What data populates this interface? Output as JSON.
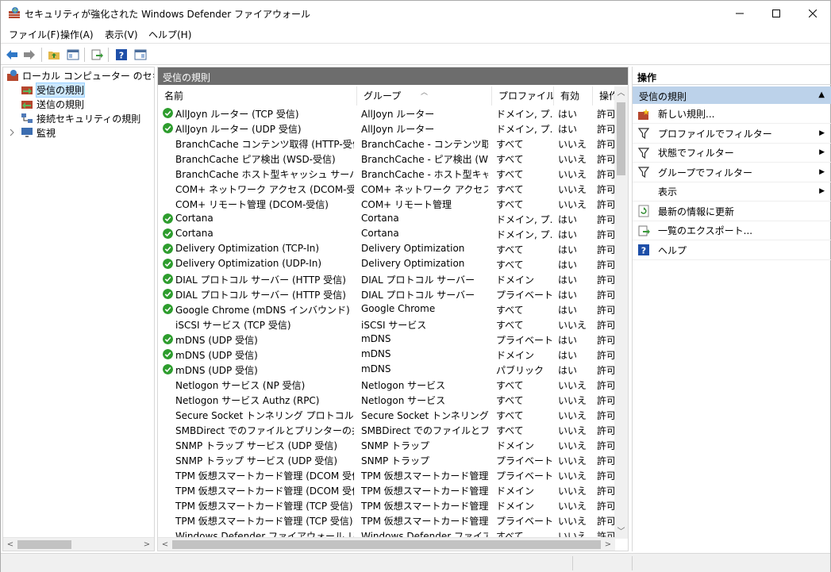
{
  "window": {
    "title": "セキュリティが強化された Windows Defender ファイアウォール"
  },
  "menu": [
    "ファイル(F)",
    "操作(A)",
    "表示(V)",
    "ヘルプ(H)"
  ],
  "tree": {
    "root": "ローカル コンピューター のセキュリティ",
    "items": [
      "受信の規則",
      "送信の規則",
      "接続セキュリティの規則",
      "監視"
    ]
  },
  "center": {
    "title": "受信の規則",
    "columns": [
      "名前",
      "グループ",
      "プロファイル",
      "有効",
      "操作"
    ],
    "rows": [
      {
        "name": "AllJoyn ルーター (TCP 受信)",
        "group": "AllJoyn ルーター",
        "profile": "ドメイン, プ...",
        "enabled": "はい",
        "action": "許可",
        "check": true
      },
      {
        "name": "AllJoyn ルーター (UDP 受信)",
        "group": "AllJoyn ルーター",
        "profile": "ドメイン, プ...",
        "enabled": "はい",
        "action": "許可",
        "check": true
      },
      {
        "name": "BranchCache コンテンツ取得 (HTTP-受信)",
        "group": "BranchCache - コンテンツ取得...",
        "profile": "すべて",
        "enabled": "いいえ",
        "action": "許可",
        "check": false
      },
      {
        "name": "BranchCache ピア検出 (WSD-受信)",
        "group": "BranchCache - ピア検出 (WS...",
        "profile": "すべて",
        "enabled": "いいえ",
        "action": "許可",
        "check": false
      },
      {
        "name": "BranchCache ホスト型キャッシュ サーバー (HT...",
        "group": "BranchCache - ホスト型キャッ...",
        "profile": "すべて",
        "enabled": "いいえ",
        "action": "許可",
        "check": false
      },
      {
        "name": "COM+ ネットワーク アクセス (DCOM-受信)",
        "group": "COM+ ネットワーク アクセス",
        "profile": "すべて",
        "enabled": "いいえ",
        "action": "許可",
        "check": false
      },
      {
        "name": "COM+ リモート管理 (DCOM-受信)",
        "group": "COM+ リモート管理",
        "profile": "すべて",
        "enabled": "いいえ",
        "action": "許可",
        "check": false
      },
      {
        "name": "Cortana",
        "group": "Cortana",
        "profile": "ドメイン, プ...",
        "enabled": "はい",
        "action": "許可",
        "check": true
      },
      {
        "name": "Cortana",
        "group": "Cortana",
        "profile": "ドメイン, プ...",
        "enabled": "はい",
        "action": "許可",
        "check": true
      },
      {
        "name": "Delivery Optimization (TCP-In)",
        "group": "Delivery Optimization",
        "profile": "すべて",
        "enabled": "はい",
        "action": "許可",
        "check": true
      },
      {
        "name": "Delivery Optimization (UDP-In)",
        "group": "Delivery Optimization",
        "profile": "すべて",
        "enabled": "はい",
        "action": "許可",
        "check": true
      },
      {
        "name": "DIAL プロトコル サーバー (HTTP 受信)",
        "group": "DIAL プロトコル サーバー",
        "profile": "ドメイン",
        "enabled": "はい",
        "action": "許可",
        "check": true
      },
      {
        "name": "DIAL プロトコル サーバー (HTTP 受信)",
        "group": "DIAL プロトコル サーバー",
        "profile": "プライベート",
        "enabled": "はい",
        "action": "許可",
        "check": true
      },
      {
        "name": "Google Chrome (mDNS インバウンド)",
        "group": "Google Chrome",
        "profile": "すべて",
        "enabled": "はい",
        "action": "許可",
        "check": true
      },
      {
        "name": "iSCSI サービス (TCP 受信)",
        "group": "iSCSI サービス",
        "profile": "すべて",
        "enabled": "いいえ",
        "action": "許可",
        "check": false
      },
      {
        "name": "mDNS (UDP 受信)",
        "group": "mDNS",
        "profile": "プライベート",
        "enabled": "はい",
        "action": "許可",
        "check": true
      },
      {
        "name": "mDNS (UDP 受信)",
        "group": "mDNS",
        "profile": "ドメイン",
        "enabled": "はい",
        "action": "許可",
        "check": true
      },
      {
        "name": "mDNS (UDP 受信)",
        "group": "mDNS",
        "profile": "パブリック",
        "enabled": "はい",
        "action": "許可",
        "check": true
      },
      {
        "name": "Netlogon サービス (NP 受信)",
        "group": "Netlogon サービス",
        "profile": "すべて",
        "enabled": "いいえ",
        "action": "許可",
        "check": false
      },
      {
        "name": "Netlogon サービス Authz (RPC)",
        "group": "Netlogon サービス",
        "profile": "すべて",
        "enabled": "いいえ",
        "action": "許可",
        "check": false
      },
      {
        "name": "Secure Socket トンネリング プロトコル (SSTP ...",
        "group": "Secure Socket トンネリング プ...",
        "profile": "すべて",
        "enabled": "いいえ",
        "action": "許可",
        "check": false
      },
      {
        "name": "SMBDirect でのファイルとプリンターの共有 (i...",
        "group": "SMBDirect でのファイルとプリン...",
        "profile": "すべて",
        "enabled": "いいえ",
        "action": "許可",
        "check": false
      },
      {
        "name": "SNMP トラップ サービス (UDP 受信)",
        "group": "SNMP トラップ",
        "profile": "ドメイン",
        "enabled": "いいえ",
        "action": "許可",
        "check": false
      },
      {
        "name": "SNMP トラップ サービス (UDP 受信)",
        "group": "SNMP トラップ",
        "profile": "プライベート,...",
        "enabled": "いいえ",
        "action": "許可",
        "check": false
      },
      {
        "name": "TPM 仮想スマートカード管理 (DCOM 受信)",
        "group": "TPM 仮想スマートカード管理",
        "profile": "プライベート,...",
        "enabled": "いいえ",
        "action": "許可",
        "check": false
      },
      {
        "name": "TPM 仮想スマートカード管理 (DCOM 受信)",
        "group": "TPM 仮想スマートカード管理",
        "profile": "ドメイン",
        "enabled": "いいえ",
        "action": "許可",
        "check": false
      },
      {
        "name": "TPM 仮想スマートカード管理 (TCP 受信)",
        "group": "TPM 仮想スマートカード管理",
        "profile": "ドメイン",
        "enabled": "いいえ",
        "action": "許可",
        "check": false
      },
      {
        "name": "TPM 仮想スマートカード管理 (TCP 受信)",
        "group": "TPM 仮想スマートカード管理",
        "profile": "プライベート,...",
        "enabled": "いいえ",
        "action": "許可",
        "check": false
      },
      {
        "name": "Windows Defender ファイアウォール リモート...",
        "group": "Windows Defender ファイアウ...",
        "profile": "すべて",
        "enabled": "いいえ",
        "action": "許可",
        "check": false
      }
    ]
  },
  "actions": {
    "header": "操作",
    "section": "受信の規則",
    "items": [
      {
        "label": "新しい規則...",
        "icon": "new-rule-icon",
        "submenu": false
      },
      {
        "label": "プロファイルでフィルター",
        "icon": "filter-icon",
        "submenu": true
      },
      {
        "label": "状態でフィルター",
        "icon": "filter-icon",
        "submenu": true
      },
      {
        "label": "グループでフィルター",
        "icon": "filter-icon",
        "submenu": true
      },
      {
        "label": "表示",
        "icon": "",
        "submenu": true
      },
      {
        "label": "最新の情報に更新",
        "icon": "refresh-icon",
        "submenu": false
      },
      {
        "label": "一覧のエクスポート...",
        "icon": "export-icon",
        "submenu": false
      },
      {
        "label": "ヘルプ",
        "icon": "help-icon",
        "submenu": false
      }
    ]
  },
  "colors": {
    "selection": "#cce8ff",
    "pane_title": "#6d6d6d",
    "action_section": "#bcd2ea",
    "check_green": "#2e9d2e"
  }
}
